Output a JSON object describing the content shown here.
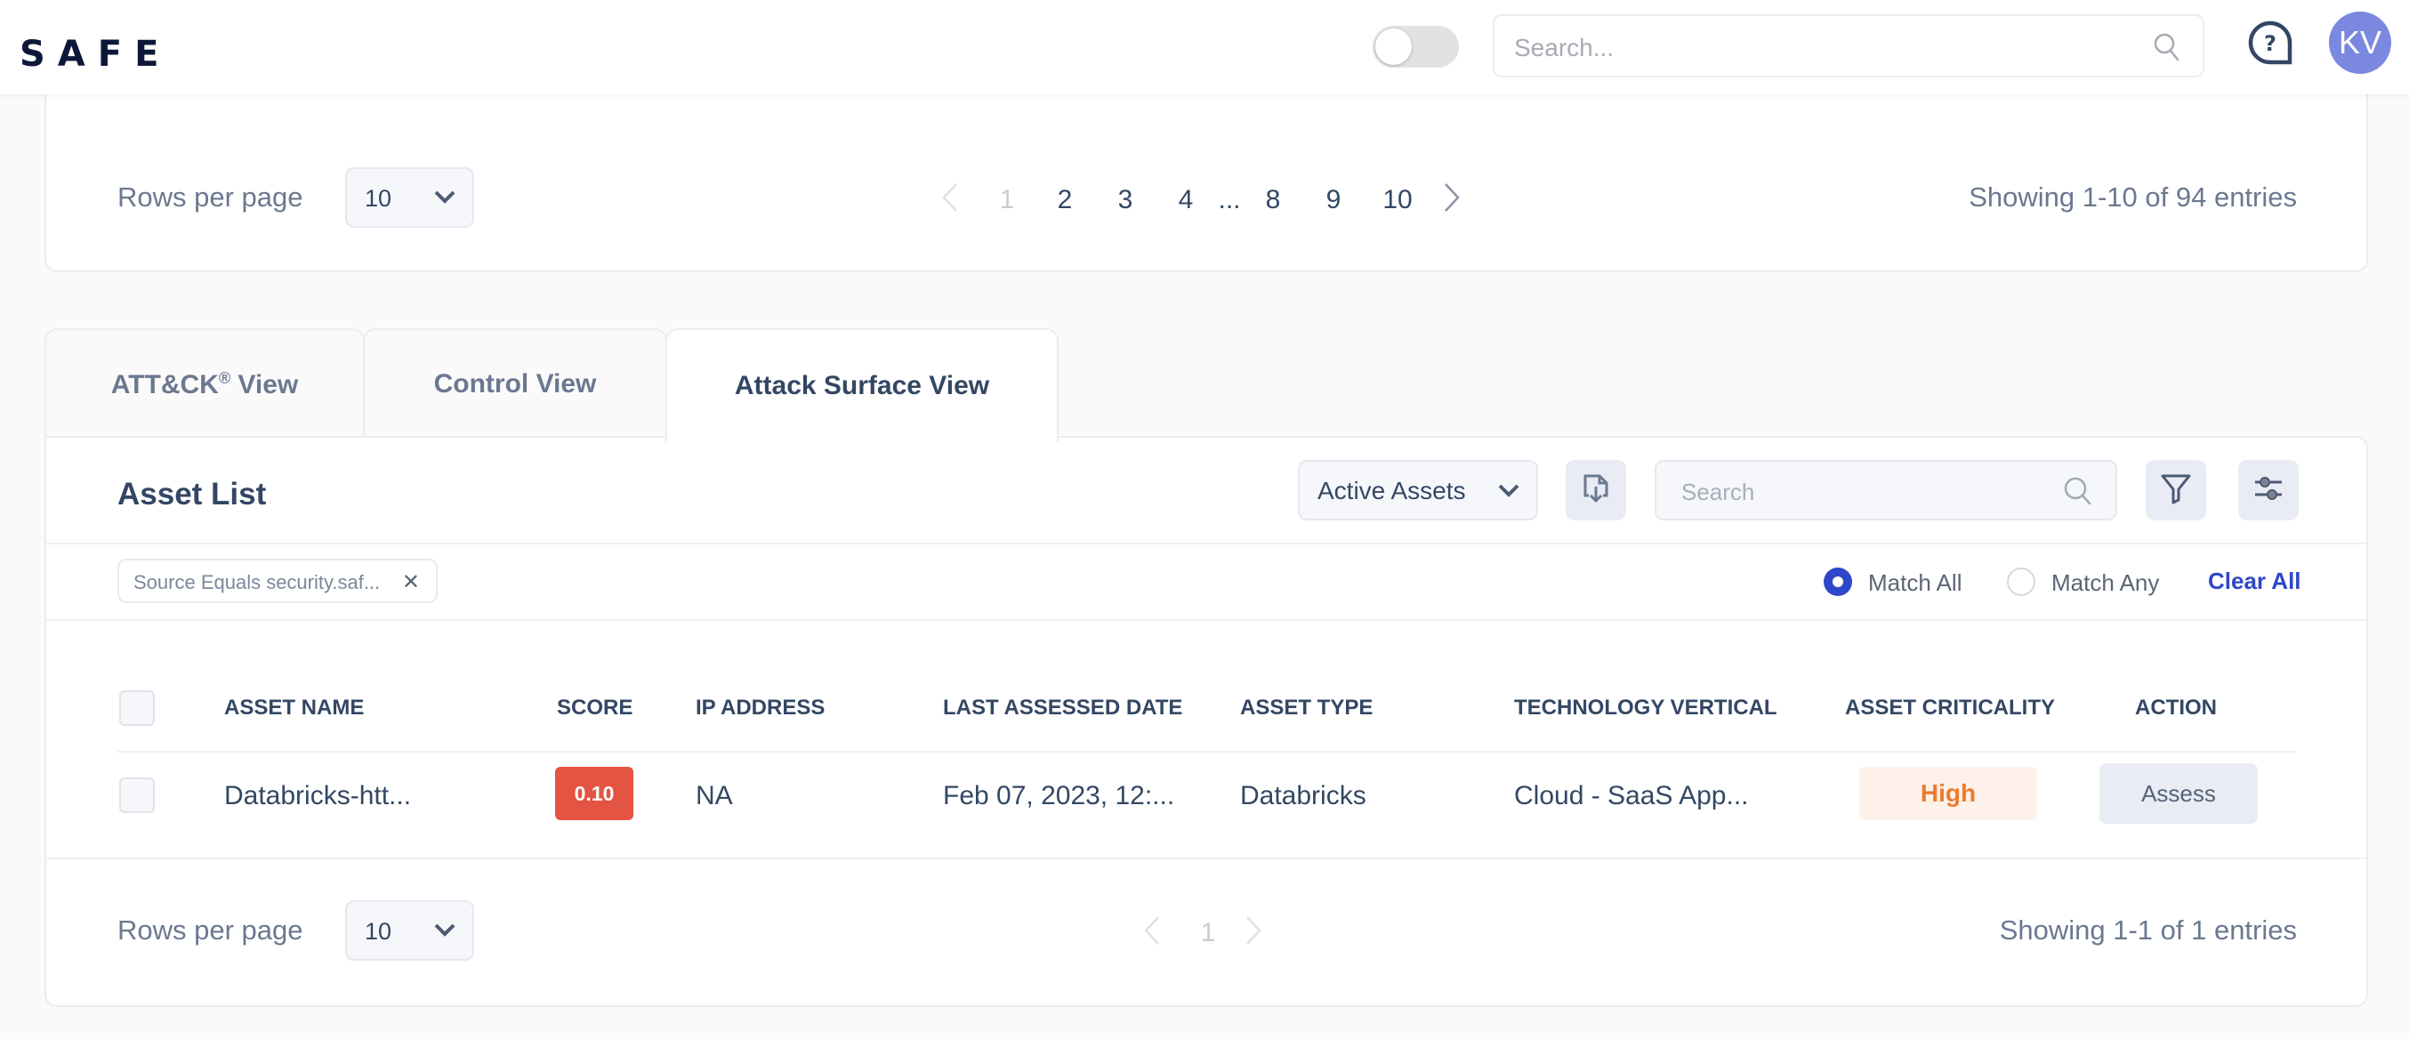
{
  "header": {
    "logo": "SAFE",
    "theme_toggle": {
      "on": false
    },
    "search_placeholder": "Search...",
    "help_icon": "help-bubble-icon",
    "avatar_initials": "KV"
  },
  "top_pagination": {
    "rows_per_page_label": "Rows per page",
    "rows_per_page_value": "10",
    "pages": [
      "1",
      "2",
      "3",
      "4",
      "...",
      "8",
      "9",
      "10"
    ],
    "current_page": "1",
    "showing": "Showing 1-10 of 94 entries"
  },
  "tabs": [
    {
      "label": "ATT&CK",
      "sup": "®",
      "suffix": " View",
      "active": false
    },
    {
      "label": "Control View",
      "active": false
    },
    {
      "label": "Attack Surface View",
      "active": true
    }
  ],
  "asset_list": {
    "title": "Asset List",
    "asset_filter_select": "Active Assets",
    "search_placeholder": "Search",
    "filter_chip": "Source Equals security.saf...",
    "match_all_label": "Match All",
    "match_any_label": "Match Any",
    "match_mode": "all",
    "clear_all_label": "Clear All",
    "columns": [
      "ASSET NAME",
      "SCORE",
      "IP ADDRESS",
      "LAST ASSESSED DATE",
      "ASSET TYPE",
      "TECHNOLOGY VERTICAL",
      "ASSET CRITICALITY",
      "ACTION"
    ],
    "rows": [
      {
        "asset_name": "Databricks-htt...",
        "score": "0.10",
        "ip_address": "NA",
        "last_assessed": "Feb 07, 2023, 12:...",
        "asset_type": "Databricks",
        "technology_vertical": "Cloud - SaaS App...",
        "criticality": "High",
        "action": "Assess"
      }
    ]
  },
  "bottom_pagination": {
    "rows_per_page_label": "Rows per page",
    "rows_per_page_value": "10",
    "pages": [
      "1"
    ],
    "current_page": "1",
    "showing": "Showing 1-1 of 1 entries"
  },
  "colors": {
    "accent": "#2e47c8",
    "score_bad": "#e45443",
    "criticality_high_text": "#ec7b2f",
    "criticality_high_bg": "#fdf1e9",
    "avatar": "#7a88e0"
  }
}
